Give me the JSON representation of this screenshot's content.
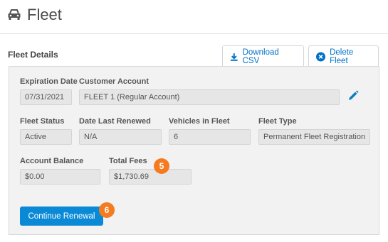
{
  "page": {
    "title": "Fleet",
    "icon": "car-icon"
  },
  "section": {
    "title": "Fleet Details"
  },
  "actions": {
    "download": {
      "label": "Download CSV",
      "icon": "download-icon"
    },
    "delete": {
      "label": "Delete Fleet",
      "icon": "close-circle-icon"
    }
  },
  "fields": {
    "expiration_date": {
      "label": "Expiration Date",
      "value": "07/31/2021"
    },
    "customer_account": {
      "label": "Customer Account",
      "value": "FLEET 1 (Regular Account)"
    },
    "fleet_status": {
      "label": "Fleet Status",
      "value": "Active"
    },
    "date_last_renewed": {
      "label": "Date Last Renewed",
      "value": "N/A"
    },
    "vehicles_in_fleet": {
      "label": "Vehicles in Fleet",
      "value": "6"
    },
    "fleet_type": {
      "label": "Fleet Type",
      "value": "Permanent Fleet Registration"
    },
    "account_balance": {
      "label": "Account Balance",
      "value": "$0.00"
    },
    "total_fees": {
      "label": "Total Fees",
      "value": "$1,730.69"
    }
  },
  "edit_icon": "pencil-icon",
  "badges": {
    "total_fees_step": "5",
    "continue_step": "6"
  },
  "primary_button": {
    "label": "Continue Renewal"
  },
  "colors": {
    "accent": "#0a8ad6",
    "badge": "#f47b20",
    "link": "#0072c6"
  }
}
